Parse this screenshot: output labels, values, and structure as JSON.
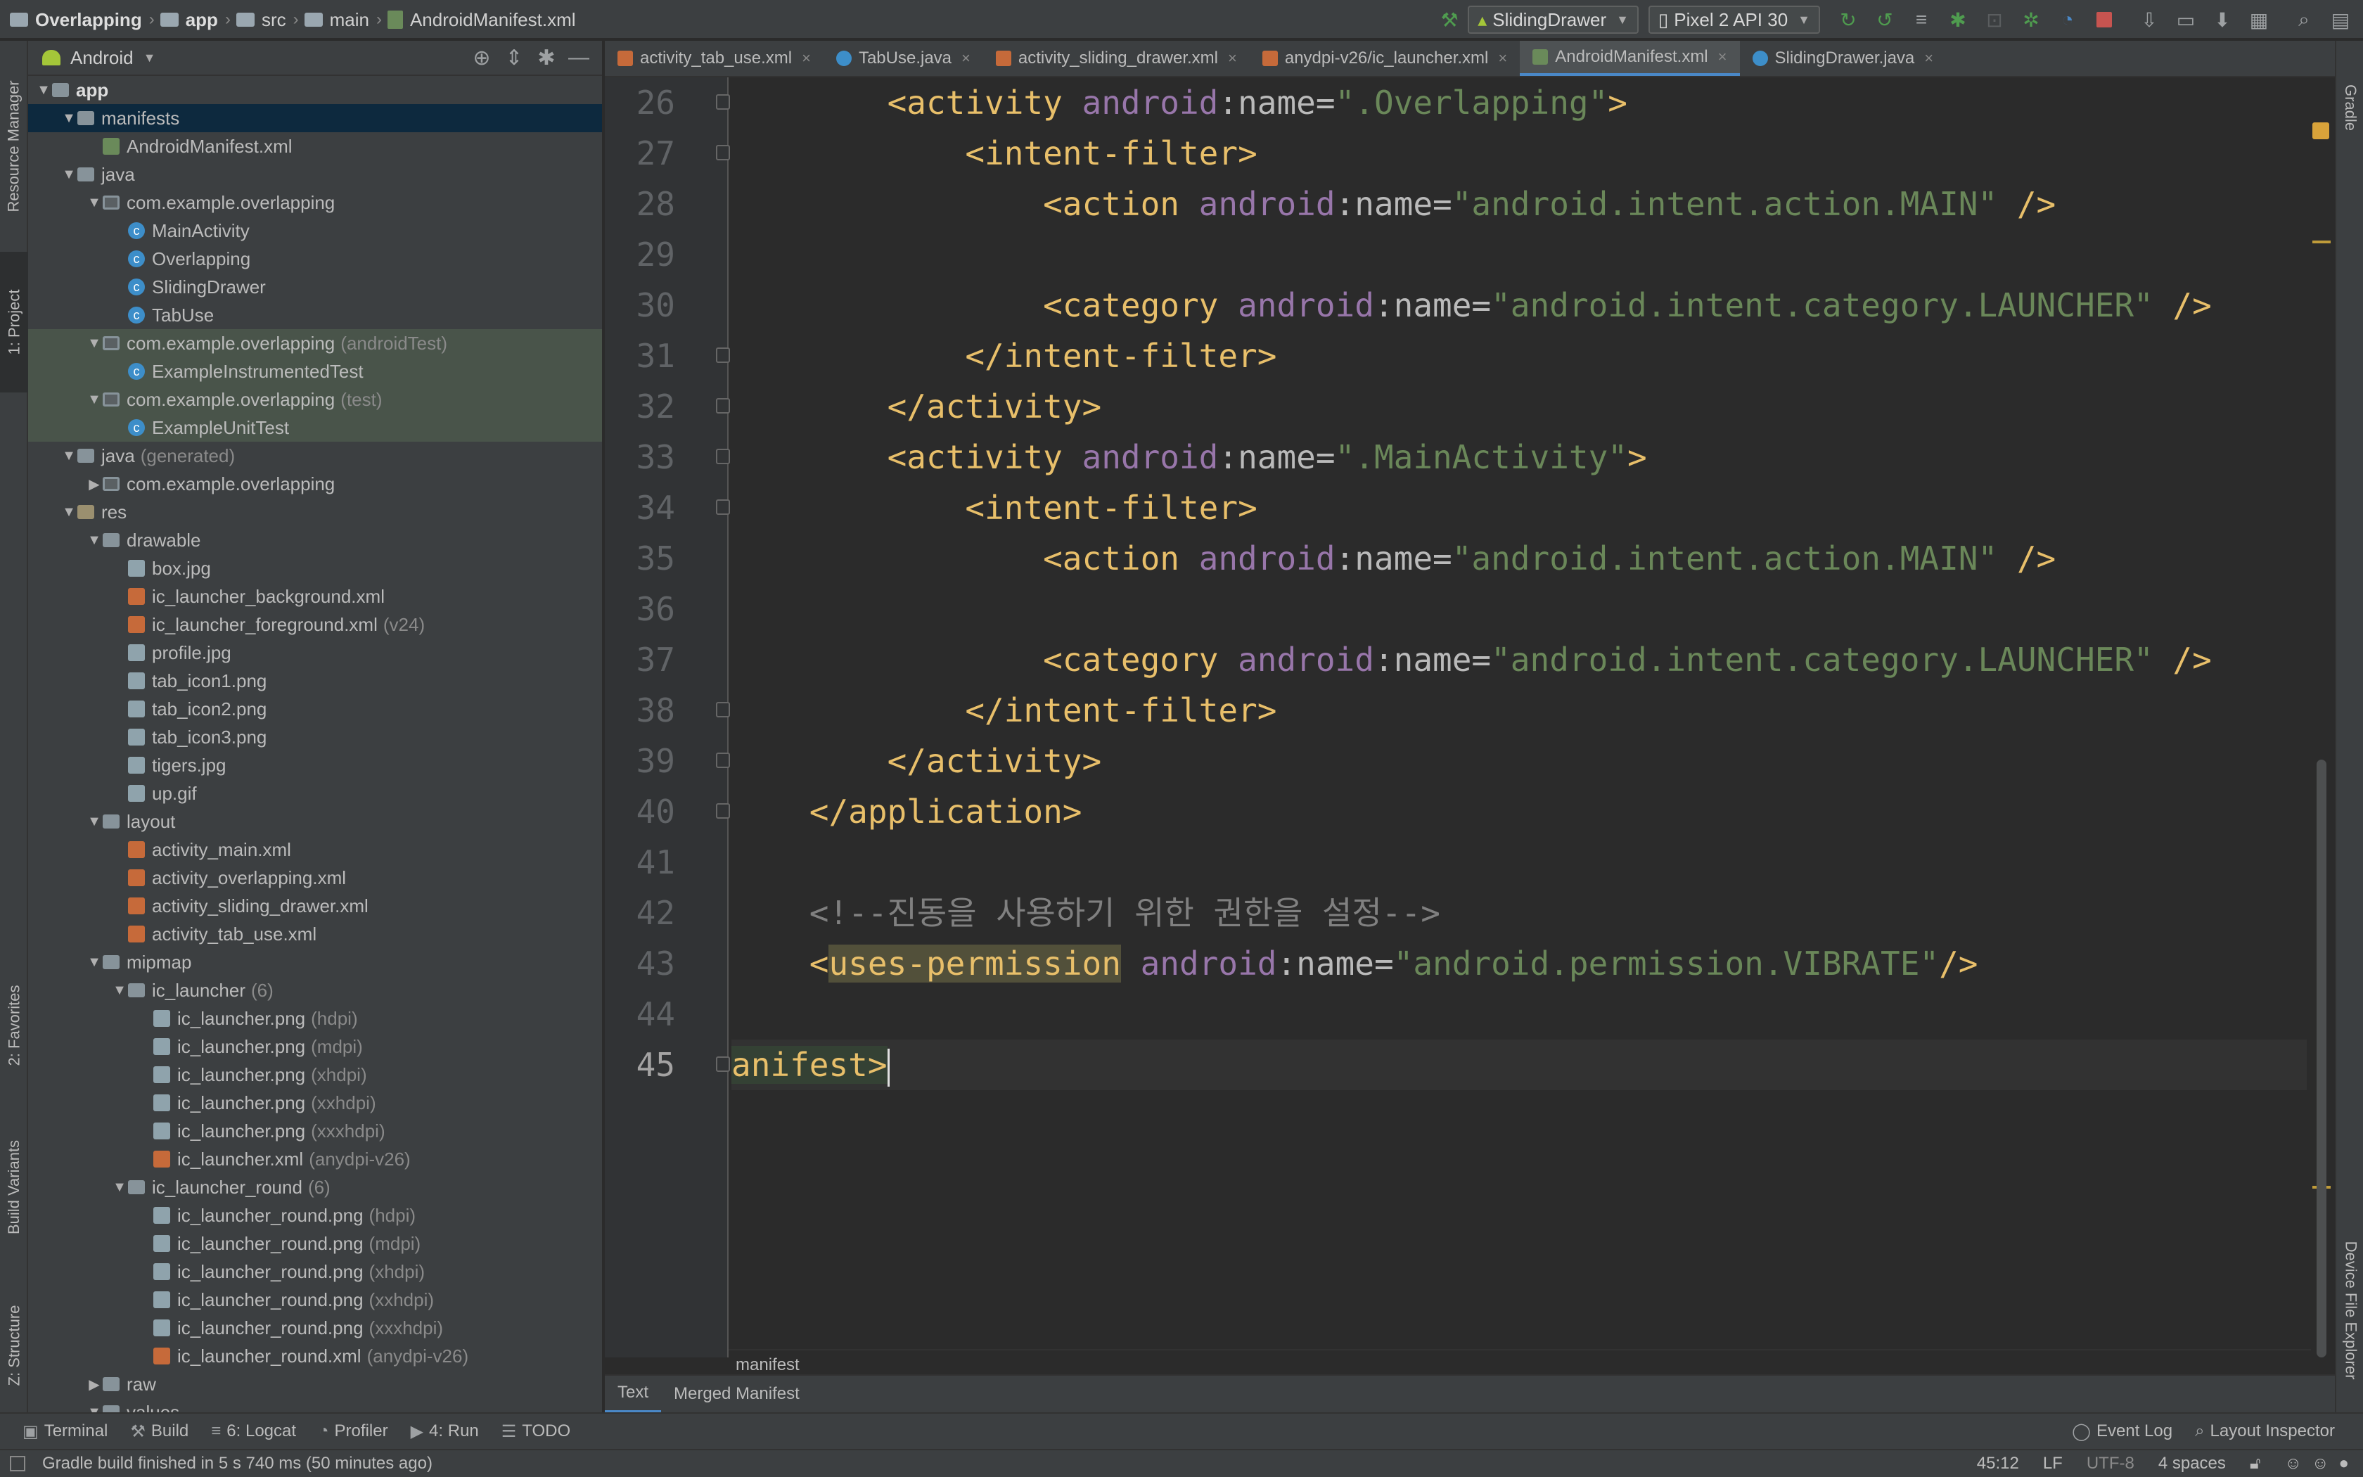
{
  "breadcrumb": [
    {
      "label": "Overlapping",
      "icon": "folder-icon",
      "bold": true
    },
    {
      "label": "app",
      "icon": "module-folder-icon",
      "bold": true
    },
    {
      "label": "src",
      "icon": "folder-icon",
      "bold": false
    },
    {
      "label": "main",
      "icon": "folder-icon",
      "bold": false
    },
    {
      "label": "AndroidManifest.xml",
      "icon": "manifest-file-icon",
      "bold": false
    }
  ],
  "toolbar": {
    "run_config": "SlidingDrawer",
    "device": "Pixel 2 API 30"
  },
  "left_strip": [
    "Resource Manager",
    "1: Project",
    "2: Favorites",
    "Build Variants",
    "Z: Structure"
  ],
  "right_strip": [
    "Gradle",
    "Device File Explorer"
  ],
  "project_panel": {
    "view": "Android",
    "tree": [
      {
        "d": 0,
        "label": "app",
        "type": "folder",
        "exp": "down",
        "bold": true
      },
      {
        "d": 1,
        "label": "manifests",
        "type": "folder",
        "exp": "down",
        "sel": true
      },
      {
        "d": 2,
        "label": "AndroidManifest.xml",
        "type": "man"
      },
      {
        "d": 1,
        "label": "java",
        "type": "folder",
        "exp": "down"
      },
      {
        "d": 2,
        "label": "com.example.overlapping",
        "type": "pkg",
        "exp": "down"
      },
      {
        "d": 3,
        "label": "MainActivity",
        "type": "cls"
      },
      {
        "d": 3,
        "label": "Overlapping",
        "type": "cls"
      },
      {
        "d": 3,
        "label": "SlidingDrawer",
        "type": "cls"
      },
      {
        "d": 3,
        "label": "TabUse",
        "type": "cls"
      },
      {
        "d": 2,
        "label": "com.example.overlapping",
        "hint": "(androidTest)",
        "type": "pkg",
        "exp": "down",
        "test": true
      },
      {
        "d": 3,
        "label": "ExampleInstrumentedTest",
        "type": "cls",
        "test": true
      },
      {
        "d": 2,
        "label": "com.example.overlapping",
        "hint": "(test)",
        "type": "pkg",
        "exp": "down",
        "test": true
      },
      {
        "d": 3,
        "label": "ExampleUnitTest",
        "type": "cls",
        "test": true
      },
      {
        "d": 1,
        "label": "java",
        "hint": "(generated)",
        "type": "folder",
        "exp": "down"
      },
      {
        "d": 2,
        "label": "com.example.overlapping",
        "type": "pkg",
        "exp": "right"
      },
      {
        "d": 1,
        "label": "res",
        "type": "res",
        "exp": "down"
      },
      {
        "d": 2,
        "label": "drawable",
        "type": "folder",
        "exp": "down"
      },
      {
        "d": 3,
        "label": "box.jpg",
        "type": "img"
      },
      {
        "d": 3,
        "label": "ic_launcher_background.xml",
        "type": "xml"
      },
      {
        "d": 3,
        "label": "ic_launcher_foreground.xml",
        "hint": "(v24)",
        "type": "xml"
      },
      {
        "d": 3,
        "label": "profile.jpg",
        "type": "img"
      },
      {
        "d": 3,
        "label": "tab_icon1.png",
        "type": "img"
      },
      {
        "d": 3,
        "label": "tab_icon2.png",
        "type": "img"
      },
      {
        "d": 3,
        "label": "tab_icon3.png",
        "type": "img"
      },
      {
        "d": 3,
        "label": "tigers.jpg",
        "type": "img"
      },
      {
        "d": 3,
        "label": "up.gif",
        "type": "img"
      },
      {
        "d": 2,
        "label": "layout",
        "type": "folder",
        "exp": "down"
      },
      {
        "d": 3,
        "label": "activity_main.xml",
        "type": "xml"
      },
      {
        "d": 3,
        "label": "activity_overlapping.xml",
        "type": "xml"
      },
      {
        "d": 3,
        "label": "activity_sliding_drawer.xml",
        "type": "xml"
      },
      {
        "d": 3,
        "label": "activity_tab_use.xml",
        "type": "xml"
      },
      {
        "d": 2,
        "label": "mipmap",
        "type": "folder",
        "exp": "down"
      },
      {
        "d": 3,
        "label": "ic_launcher",
        "hint": "(6)",
        "type": "folder",
        "exp": "down"
      },
      {
        "d": 4,
        "label": "ic_launcher.png",
        "hint": "(hdpi)",
        "type": "img"
      },
      {
        "d": 4,
        "label": "ic_launcher.png",
        "hint": "(mdpi)",
        "type": "img"
      },
      {
        "d": 4,
        "label": "ic_launcher.png",
        "hint": "(xhdpi)",
        "type": "img"
      },
      {
        "d": 4,
        "label": "ic_launcher.png",
        "hint": "(xxhdpi)",
        "type": "img"
      },
      {
        "d": 4,
        "label": "ic_launcher.png",
        "hint": "(xxxhdpi)",
        "type": "img"
      },
      {
        "d": 4,
        "label": "ic_launcher.xml",
        "hint": "(anydpi-v26)",
        "type": "xml"
      },
      {
        "d": 3,
        "label": "ic_launcher_round",
        "hint": "(6)",
        "type": "folder",
        "exp": "down"
      },
      {
        "d": 4,
        "label": "ic_launcher_round.png",
        "hint": "(hdpi)",
        "type": "img"
      },
      {
        "d": 4,
        "label": "ic_launcher_round.png",
        "hint": "(mdpi)",
        "type": "img"
      },
      {
        "d": 4,
        "label": "ic_launcher_round.png",
        "hint": "(xhdpi)",
        "type": "img"
      },
      {
        "d": 4,
        "label": "ic_launcher_round.png",
        "hint": "(xxhdpi)",
        "type": "img"
      },
      {
        "d": 4,
        "label": "ic_launcher_round.png",
        "hint": "(xxxhdpi)",
        "type": "img"
      },
      {
        "d": 4,
        "label": "ic_launcher_round.xml",
        "hint": "(anydpi-v26)",
        "type": "xml"
      },
      {
        "d": 2,
        "label": "raw",
        "type": "folder",
        "exp": "right"
      },
      {
        "d": 2,
        "label": "values",
        "type": "folder",
        "exp": "down"
      }
    ]
  },
  "editor_tabs": [
    {
      "label": "activity_tab_use.xml",
      "icon": "xml",
      "active": false
    },
    {
      "label": "TabUse.java",
      "icon": "c",
      "active": false
    },
    {
      "label": "activity_sliding_drawer.xml",
      "icon": "xml",
      "active": false
    },
    {
      "label": "anydpi-v26/ic_launcher.xml",
      "icon": "xml",
      "active": false
    },
    {
      "label": "AndroidManifest.xml",
      "icon": "m",
      "active": true
    },
    {
      "label": "SlidingDrawer.java",
      "icon": "c",
      "active": false
    }
  ],
  "code": {
    "current_line": "45",
    "lines": [
      {
        "n": "26",
        "parts": [
          [
            "",
            "        "
          ],
          [
            "t-tag",
            "<activity "
          ],
          [
            "t-ns",
            "android"
          ],
          [
            "t-attr",
            ":name="
          ],
          [
            "t-val",
            "\".Overlapping\""
          ],
          [
            "t-tag",
            ">"
          ]
        ]
      },
      {
        "n": "27",
        "parts": [
          [
            "",
            "            "
          ],
          [
            "t-tag",
            "<intent-filter>"
          ]
        ]
      },
      {
        "n": "28",
        "parts": [
          [
            "",
            "                "
          ],
          [
            "t-tag",
            "<action "
          ],
          [
            "t-ns",
            "android"
          ],
          [
            "t-attr",
            ":name="
          ],
          [
            "t-val",
            "\"android.intent.action.MAIN\""
          ],
          [
            "t-tag",
            " />"
          ]
        ]
      },
      {
        "n": "29",
        "parts": []
      },
      {
        "n": "30",
        "parts": [
          [
            "",
            "                "
          ],
          [
            "t-tag",
            "<category "
          ],
          [
            "t-ns",
            "android"
          ],
          [
            "t-attr",
            ":name="
          ],
          [
            "t-val",
            "\"android.intent.category.LAUNCHER\""
          ],
          [
            "t-tag",
            " />"
          ]
        ]
      },
      {
        "n": "31",
        "parts": [
          [
            "",
            "            "
          ],
          [
            "t-tag",
            "</intent-filter>"
          ]
        ]
      },
      {
        "n": "32",
        "parts": [
          [
            "",
            "        "
          ],
          [
            "t-tag",
            "</activity>"
          ]
        ]
      },
      {
        "n": "33",
        "parts": [
          [
            "",
            "        "
          ],
          [
            "t-tag",
            "<activity "
          ],
          [
            "t-ns",
            "android"
          ],
          [
            "t-attr",
            ":name="
          ],
          [
            "t-val",
            "\".MainActivity\""
          ],
          [
            "t-tag",
            ">"
          ]
        ]
      },
      {
        "n": "34",
        "parts": [
          [
            "",
            "            "
          ],
          [
            "t-tag",
            "<intent-filter>"
          ]
        ]
      },
      {
        "n": "35",
        "parts": [
          [
            "",
            "                "
          ],
          [
            "t-tag",
            "<action "
          ],
          [
            "t-ns",
            "android"
          ],
          [
            "t-attr",
            ":name="
          ],
          [
            "t-val",
            "\"android.intent.action.MAIN\""
          ],
          [
            "t-tag",
            " />"
          ]
        ]
      },
      {
        "n": "36",
        "parts": []
      },
      {
        "n": "37",
        "parts": [
          [
            "",
            "                "
          ],
          [
            "t-tag",
            "<category "
          ],
          [
            "t-ns",
            "android"
          ],
          [
            "t-attr",
            ":name="
          ],
          [
            "t-val",
            "\"android.intent.category.LAUNCHER\""
          ],
          [
            "t-tag",
            " />"
          ]
        ]
      },
      {
        "n": "38",
        "parts": [
          [
            "",
            "            "
          ],
          [
            "t-tag",
            "</intent-filter>"
          ]
        ]
      },
      {
        "n": "39",
        "parts": [
          [
            "",
            "        "
          ],
          [
            "t-tag",
            "</activity>"
          ]
        ]
      },
      {
        "n": "40",
        "parts": [
          [
            "",
            "    "
          ],
          [
            "t-tag",
            "</application>"
          ]
        ]
      },
      {
        "n": "41",
        "parts": []
      },
      {
        "n": "42",
        "parts": [
          [
            "",
            "    "
          ],
          [
            "t-com",
            "<!--진동을 사용하기 위한 권한을 설정-->"
          ]
        ]
      },
      {
        "n": "43",
        "parts": [
          [
            "",
            "    "
          ],
          [
            "t-tag",
            "<"
          ],
          [
            "t-tag hl",
            "uses-permission"
          ],
          [
            "t-ns",
            " android"
          ],
          [
            "t-attr",
            ":name="
          ],
          [
            "t-val",
            "\"android.permission.VIBRATE\""
          ],
          [
            "t-tag",
            "/>"
          ]
        ]
      },
      {
        "n": "44",
        "parts": []
      },
      {
        "n": "45",
        "parts": [
          [
            "t-tag hl2",
            "anifest>"
          ]
        ]
      }
    ]
  },
  "editor_breadcrumb": "manifest",
  "editor_subtabs": [
    {
      "label": "Text",
      "active": true
    },
    {
      "label": "Merged Manifest",
      "active": false
    }
  ],
  "tool_windows": [
    {
      "glyph": "▣",
      "label": "Terminal"
    },
    {
      "glyph": "⚒",
      "label": "Build"
    },
    {
      "glyph": "≡",
      "label": "6: Logcat"
    },
    {
      "glyph": "◔",
      "label": "Profiler"
    },
    {
      "glyph": "▶",
      "label": "4: Run"
    },
    {
      "glyph": "☰",
      "label": "TODO"
    }
  ],
  "tool_windows_right": [
    {
      "glyph": "◯",
      "label": "Event Log"
    },
    {
      "glyph": "⌕",
      "label": "Layout Inspector"
    }
  ],
  "status": {
    "message": "Gradle build finished in 5 s 740 ms (50 minutes ago)",
    "position": "45:12",
    "line_sep": "LF",
    "encoding": "UTF-8",
    "indent": "4 spaces"
  }
}
